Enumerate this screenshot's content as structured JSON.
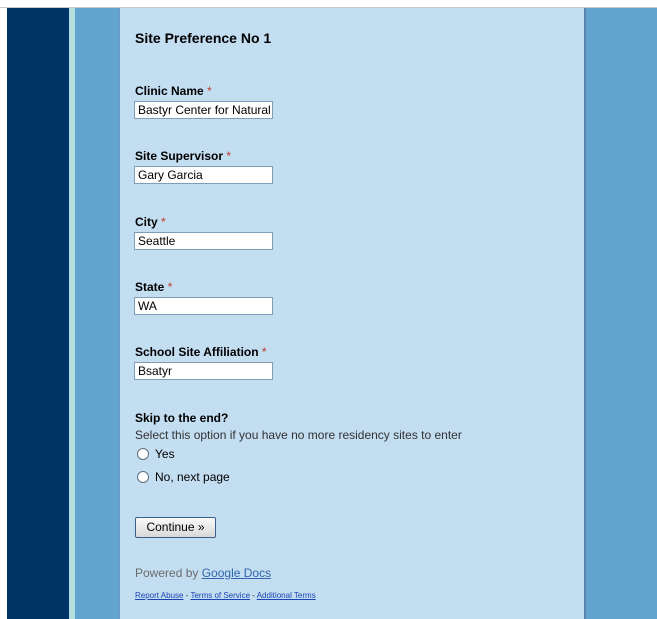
{
  "page_title": "Site Preference No 1",
  "required_marker": "*",
  "fields": [
    {
      "label": "Clinic Name",
      "value": "Bastyr Center for Natural H"
    },
    {
      "label": "Site Supervisor",
      "value": "Gary Garcia"
    },
    {
      "label": "City",
      "value": "Seattle"
    },
    {
      "label": "State",
      "value": "WA"
    },
    {
      "label": "School Site Affiliation",
      "value": "Bsatyr"
    }
  ],
  "skip_question": {
    "title": "Skip to the end?",
    "help": "Select this option if you have no more residency sites to enter",
    "options": [
      "Yes",
      "No, next page"
    ]
  },
  "continue_label": "Continue »",
  "powered_by": {
    "prefix": "Powered by",
    "link": "Google Docs"
  },
  "footer_links": {
    "report": "Report Abuse",
    "terms": "Terms of Service",
    "additional": "Additional Terms",
    "separator": " - "
  },
  "colors": {
    "navy": "#003366",
    "panel": "#c3ddf1",
    "side": "#63a4cf",
    "required": "#c0392b"
  }
}
